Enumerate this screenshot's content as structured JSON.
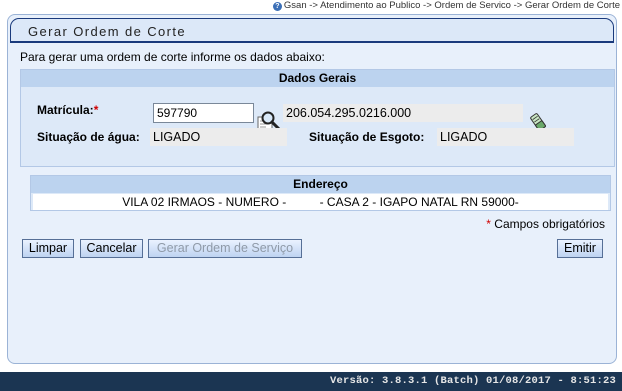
{
  "breadcrumb": "Gsan -> Atendimento ao Publico -> Ordem de Servico -> Gerar Ordem de Corte",
  "title": "Gerar Ordem de Corte",
  "intro": "Para gerar uma ordem de corte informe os dados abaixo:",
  "dados_gerais": {
    "heading": "Dados Gerais",
    "matricula_label": "Matrícula:",
    "required_mark": "*",
    "matricula_value": "597790",
    "inscricao": "206.054.295.0216.000",
    "situacao_agua_label": "Situação de água:",
    "situacao_agua_value": "LIGADO",
    "situacao_esgoto_label": "Situação de Esgoto:",
    "situacao_esgoto_value": "LIGADO"
  },
  "endereco": {
    "heading": "Endereço",
    "value": "VILA 02 IRMAOS - NUMERO -          - CASA 2 - IGAPO NATAL RN 59000-"
  },
  "campos_obrigatorios": "Campos obrigatórios",
  "buttons": {
    "limpar": "Limpar",
    "cancelar": "Cancelar",
    "gerar": "Gerar Ordem de Serviço",
    "emitir": "Emitir"
  },
  "footer": "Versão: 3.8.3.1 (Batch) 01/08/2017 - 8:51:23",
  "colors": {
    "panel_bg": "#e8f0fb",
    "section_head": "#bcd3ef",
    "footer_bg": "#1b3552",
    "required": "#d00000"
  }
}
